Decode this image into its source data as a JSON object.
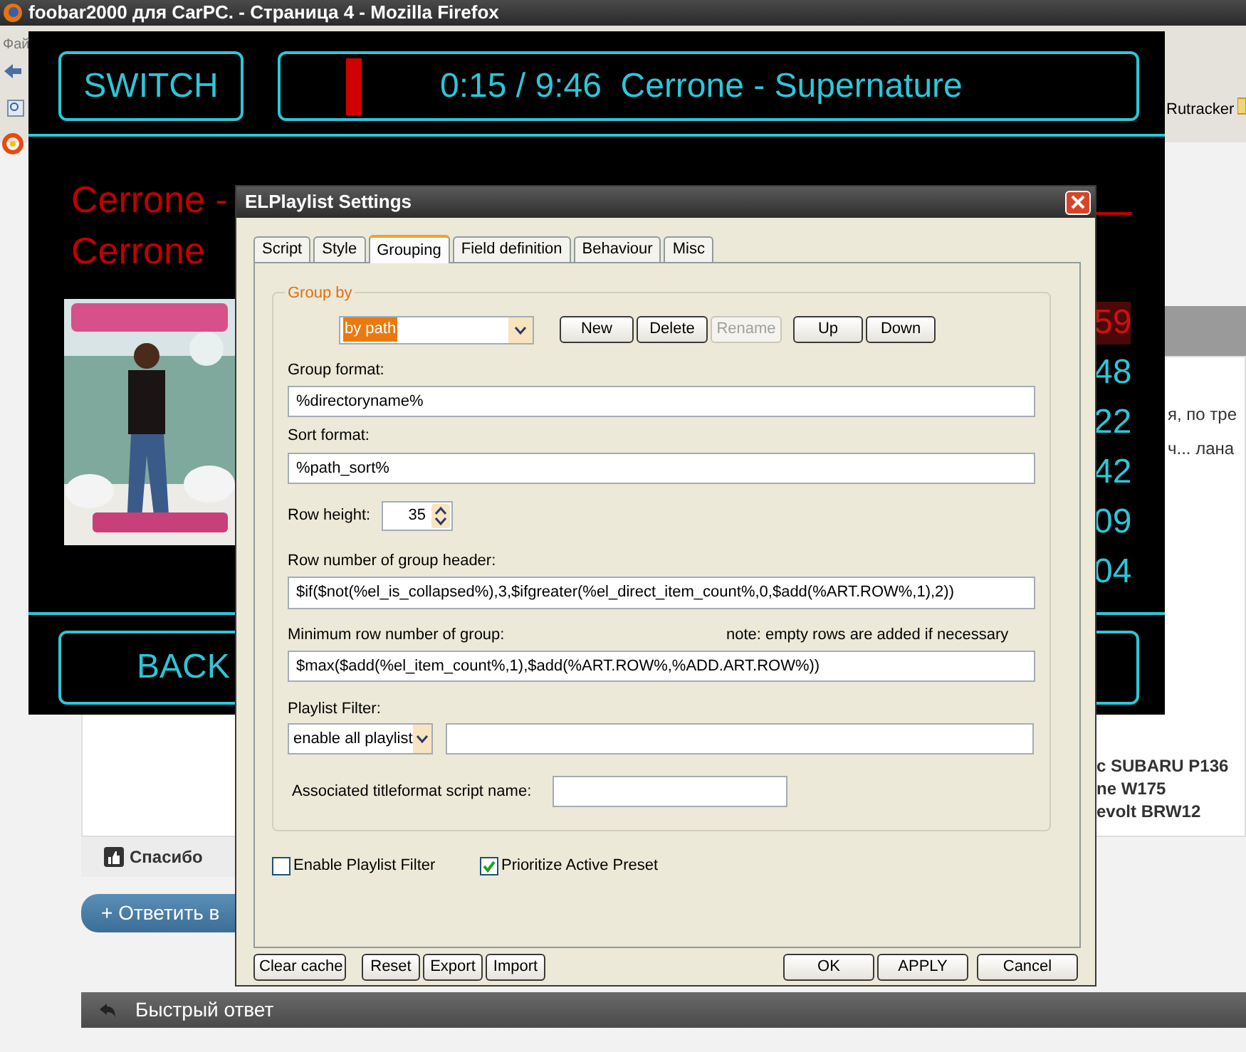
{
  "browser": {
    "title": "foobar2000 для CarPC. - Страница 4 - Mozilla Firefox",
    "menu_fragment": "Фай",
    "bookmark": "Rutracker",
    "post_fragments": [
      "я, по тре",
      "ч... лана"
    ],
    "car_list": [
      "с SUBARU P136",
      "ne W175",
      "evolt BRW12"
    ],
    "thanks_button": "Спасибо",
    "reply_button": "+ Ответить в",
    "quick_reply": "Быстрый ответ"
  },
  "player": {
    "switch_button": "SWITCH",
    "now_playing": "0:15 / 9:46  Cerrone - Supernature",
    "artist_line": "Cerrone -",
    "album_line": "Cerrone",
    "durations": [
      {
        "text": "59",
        "selected": true
      },
      {
        "text": "48",
        "selected": false
      },
      {
        "text": "22",
        "selected": false
      },
      {
        "text": "42",
        "selected": false
      },
      {
        "text": "09",
        "selected": false
      },
      {
        "text": "04",
        "selected": false
      }
    ],
    "backward_button": "BACK"
  },
  "dialog": {
    "title": "ELPlaylist Settings",
    "tabs": [
      {
        "label": "Script",
        "selected": false
      },
      {
        "label": "Style",
        "selected": false
      },
      {
        "label": "Grouping",
        "selected": true
      },
      {
        "label": "Field definition",
        "selected": false
      },
      {
        "label": "Behaviour",
        "selected": false
      },
      {
        "label": "Misc",
        "selected": false
      }
    ],
    "group_box": {
      "legend": "Group by",
      "preset": "by path",
      "buttons": [
        {
          "label": "New",
          "disabled": false
        },
        {
          "label": "Delete",
          "disabled": false
        },
        {
          "label": "Rename",
          "disabled": true
        },
        {
          "label": "Up",
          "disabled": false
        },
        {
          "label": "Down",
          "disabled": false
        }
      ],
      "group_format": {
        "label": "Group format:",
        "value": "%directoryname%"
      },
      "sort_format": {
        "label": "Sort format:",
        "value": "%path_sort%"
      },
      "row_height": {
        "label": "Row height:",
        "value": "35"
      },
      "header_rows": {
        "label": "Row number of group header:",
        "value": "$if($not(%el_is_collapsed%),3,$ifgreater(%el_direct_item_count%,0,$add(%ART.ROW%,1),2))"
      },
      "min_rows": {
        "label": "Minimum row number of group:",
        "note": "note: empty rows are added if necessary",
        "value": "$max($add(%el_item_count%,1),$add(%ART.ROW%,%ADD.ART.ROW%))"
      },
      "playlist_filter": {
        "label": "Playlist Filter:",
        "mode": "enable all playlist"
      },
      "titleformat_script": {
        "label": "Associated titleformat script name:"
      }
    },
    "checkboxes": [
      {
        "label": "Enable Playlist Filter",
        "checked": false
      },
      {
        "label": "Prioritize Active Preset",
        "checked": true
      }
    ],
    "left_buttons": [
      "Clear cache",
      "Reset",
      "Export",
      "Import"
    ],
    "right_buttons": [
      "OK",
      "APPLY",
      "Cancel"
    ]
  }
}
